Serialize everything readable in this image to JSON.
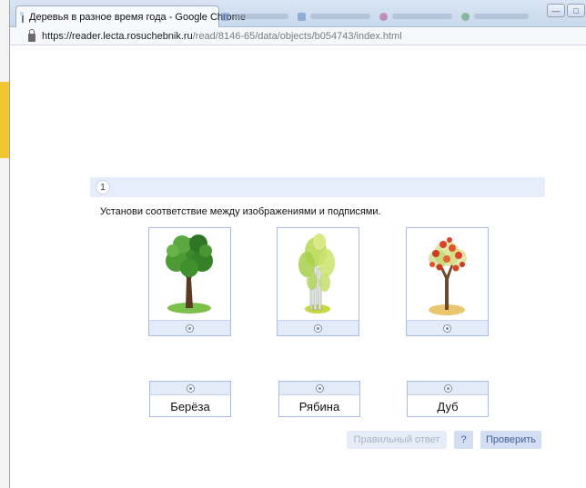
{
  "browser": {
    "tab_title": "Деревья в разное время года - Google Chrome",
    "url_host": "https://reader.lecta.rosuchebnik.ru",
    "url_path": "/read/8146-65/data/objects/b054743/index.html",
    "background_tab_colors": [
      "#6c8cc9",
      "#5d86c4",
      "#b24f8f",
      "#4a9a58"
    ]
  },
  "task": {
    "number": "1",
    "instruction": "Установи соответствие между изображениями и подписями."
  },
  "images": [
    {
      "name": "oak-summer-tree",
      "colors": {
        "crown": "#3c8a2c",
        "trunk": "#5a3b22",
        "ground": "#7bc04a"
      }
    },
    {
      "name": "birch-spring-tree",
      "colors": {
        "crown": "#b9d95a",
        "trunk": "#e8eee6",
        "ground": "#c6d940"
      }
    },
    {
      "name": "rowan-autumn-tree",
      "colors": {
        "crown": "#d8432a",
        "trunk": "#6b4a2e",
        "ground": "#e9c56e"
      }
    }
  ],
  "labels": [
    {
      "text": "Берёза"
    },
    {
      "text": "Рябина"
    },
    {
      "text": "Дуб"
    }
  ],
  "buttons": {
    "correct_answer": "Правильный ответ",
    "help": "?",
    "check": "Проверить"
  },
  "colors": {
    "accent": "#3f5f99",
    "panel": "#e7eefb",
    "card_border": "#a9bde0"
  }
}
